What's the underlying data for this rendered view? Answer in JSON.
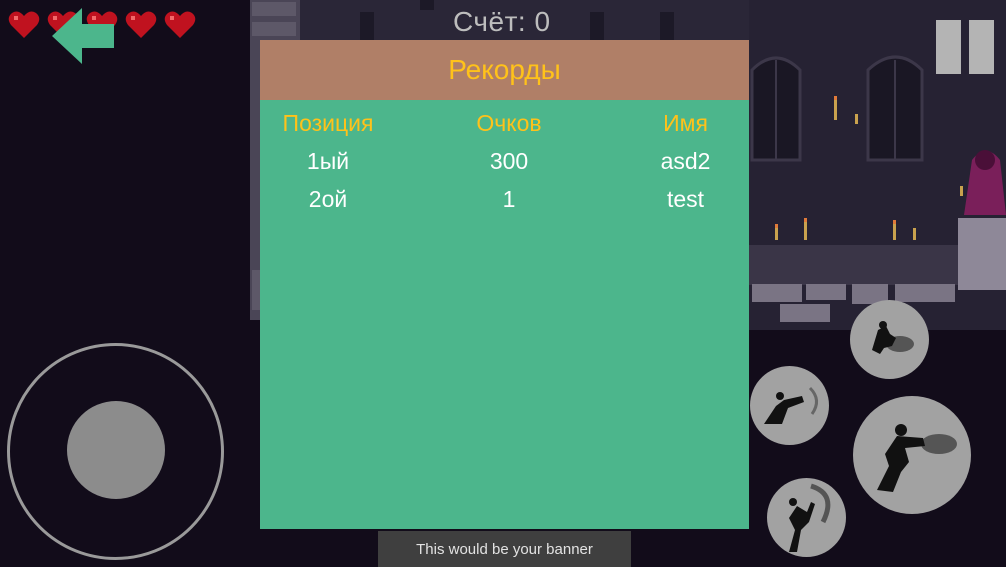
{
  "hud": {
    "hearts": 5,
    "score_label": "Счёт: 0",
    "back_icon": "left-arrow-icon",
    "pause_icon": "pause-icon"
  },
  "records": {
    "title": "Рекорды",
    "columns": [
      "Позиция",
      "Очков",
      "Имя"
    ],
    "rows": [
      [
        "1ый",
        "300",
        "asd2"
      ],
      [
        "2ой",
        "1",
        "test"
      ]
    ]
  },
  "banner": {
    "text": "This would be your banner"
  },
  "colors": {
    "panel": "#4cb68c",
    "panel_header": "#b07f67",
    "title_text": "#ffc21a",
    "heart": "#c0121f",
    "back_arrow": "#4cb68c"
  },
  "controls": {
    "joystick_icon": "virtual-joystick",
    "actions": [
      "dash-attack-icon",
      "kick-icon",
      "punch-icon",
      "uppercut-icon"
    ]
  }
}
